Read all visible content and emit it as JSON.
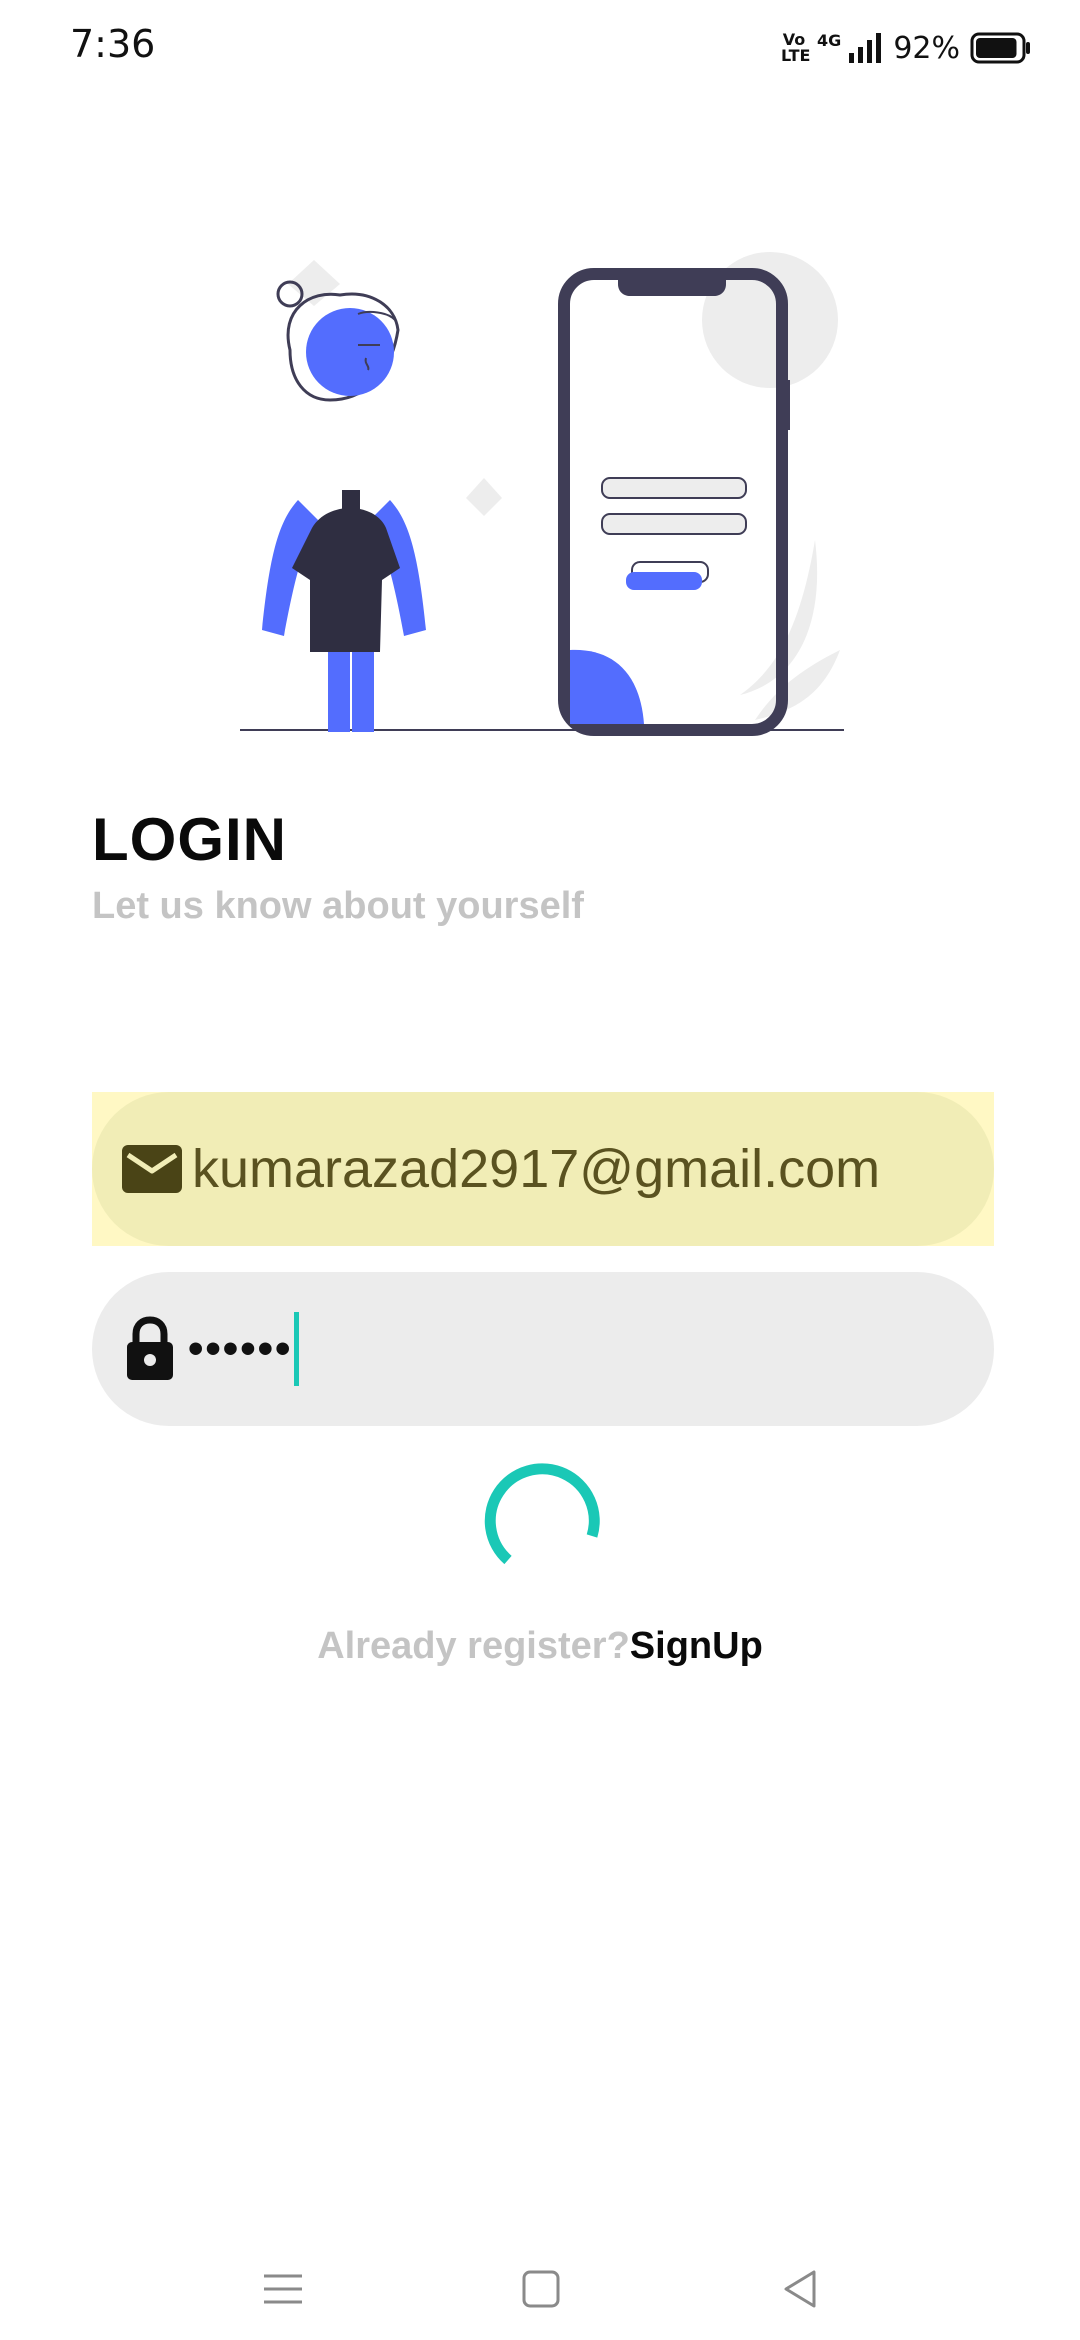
{
  "status_bar": {
    "time": "7:36",
    "volte_top": "Vo",
    "volte_bottom": "LTE",
    "network": "4G",
    "battery_percent": "92%",
    "battery_level": 0.92
  },
  "login": {
    "title": "LOGIN",
    "subtitle": "Let us know about yourself"
  },
  "form": {
    "email_value": "kumarazad2917@gmail.com",
    "password_value": "••••••",
    "loading": true
  },
  "footer": {
    "prompt": "Already register?",
    "signup_link": "SignUp"
  },
  "colors": {
    "accent_blue": "#536dfe",
    "dark_navy": "#3f3d56",
    "spinner_teal": "#1ac8b6",
    "email_fill": "#f1edb6",
    "password_fill": "#ececec"
  },
  "icons": {
    "email": "envelope-icon",
    "password": "lock-icon",
    "nav_menu": "menu-icon",
    "nav_home": "home-icon",
    "nav_back": "back-icon"
  }
}
